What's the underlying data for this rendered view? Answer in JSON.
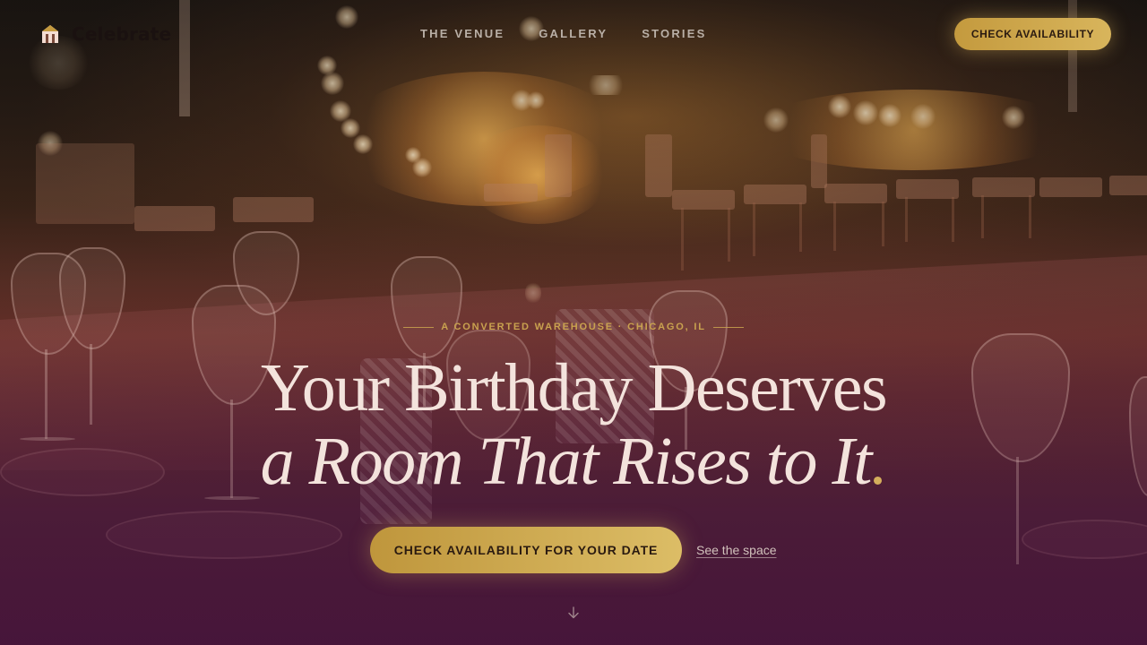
{
  "nav": {
    "logo_text": "Celebrate",
    "logo_icon": "house-icon",
    "links": [
      {
        "label": "THE VENUE"
      },
      {
        "label": "GALLERY"
      },
      {
        "label": "STORIES"
      }
    ],
    "cta_label": "CHECK AVAILABILITY"
  },
  "hero": {
    "eyebrow": "A CONVERTED WAREHOUSE · CHICAGO, IL",
    "headline_line1": "Your Birthday Deserves",
    "headline_line2": "a Room That Rises to It",
    "headline_punct": ".",
    "primary_cta": "CHECK AVAILABILITY FOR YOUR DATE",
    "secondary_cta": "See the space",
    "scroll_icon": "arrow-down-icon"
  },
  "colors": {
    "accent_gold": "#d4ae5c",
    "headline": "#f3e3dc",
    "eyebrow": "#c9a24f",
    "nav_link": "#b9afa6"
  }
}
